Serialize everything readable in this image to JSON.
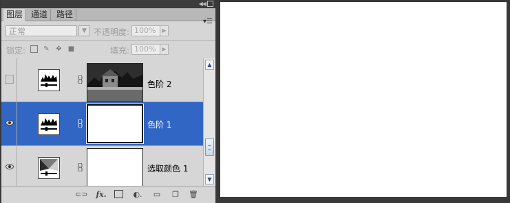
{
  "tabs": [
    {
      "label": "图层"
    },
    {
      "label": "通道"
    },
    {
      "label": "路径"
    }
  ],
  "blend": {
    "mode": "正常",
    "opacity_label": "不透明度:",
    "opacity_value": "100%"
  },
  "lock": {
    "label": "锁定:",
    "fill_label": "填充:",
    "fill_value": "100%"
  },
  "layers": [
    {
      "name": "色阶 2",
      "visible": false,
      "selected": false,
      "type": "levels"
    },
    {
      "name": "色阶 1",
      "visible": true,
      "selected": true,
      "type": "levels"
    },
    {
      "name": "选取颜色 1",
      "visible": true,
      "selected": false,
      "type": "selective-color"
    }
  ],
  "colors": {
    "selection": "#3166c4",
    "panel_bg": "#d6d6d6",
    "app_bg": "#383838"
  }
}
